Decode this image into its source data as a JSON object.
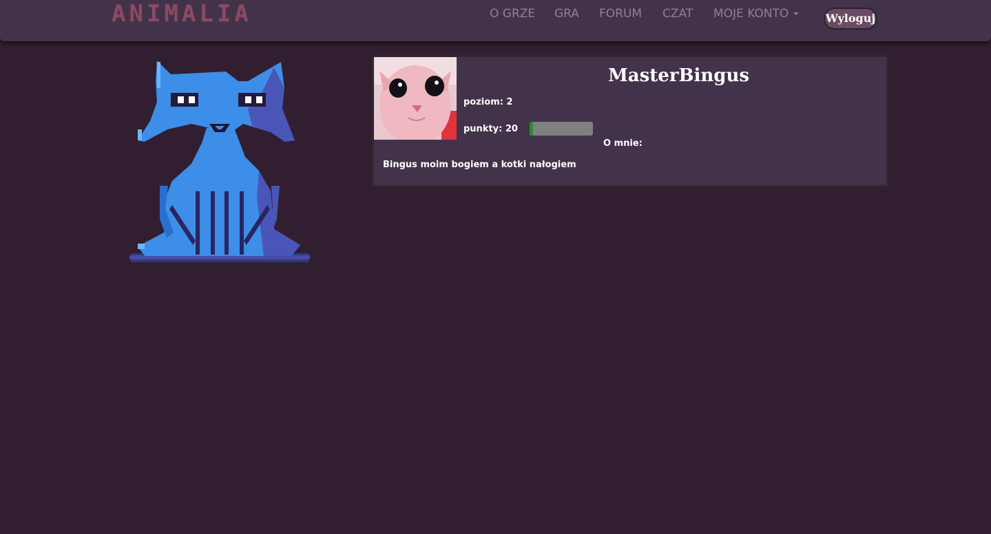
{
  "nav": {
    "logo": "ANIMALIA",
    "links": [
      "O GRZE",
      "GRA",
      "FORUM",
      "CZAT",
      "MOJE KONTO"
    ],
    "logout": "Wyloguj"
  },
  "profile": {
    "username": "MasterBingus",
    "level_text": "poziom: 2",
    "points_text": "punkty: 20",
    "points_progress": 0.05,
    "about_label": "O mnie:",
    "bio": "Bingus moim bogiem a kotki nałogiem"
  },
  "colors": {
    "page_bg": "#311f31",
    "nav_bg": "#42334a",
    "card_bg": "#42334a",
    "cat_blue": "#3d8ee8",
    "progress_fill": "#2e8b2e",
    "progress_track": "#808080"
  },
  "icons": {
    "caret": "chevron-down-icon",
    "mascot": "pixel-cat-icon"
  }
}
